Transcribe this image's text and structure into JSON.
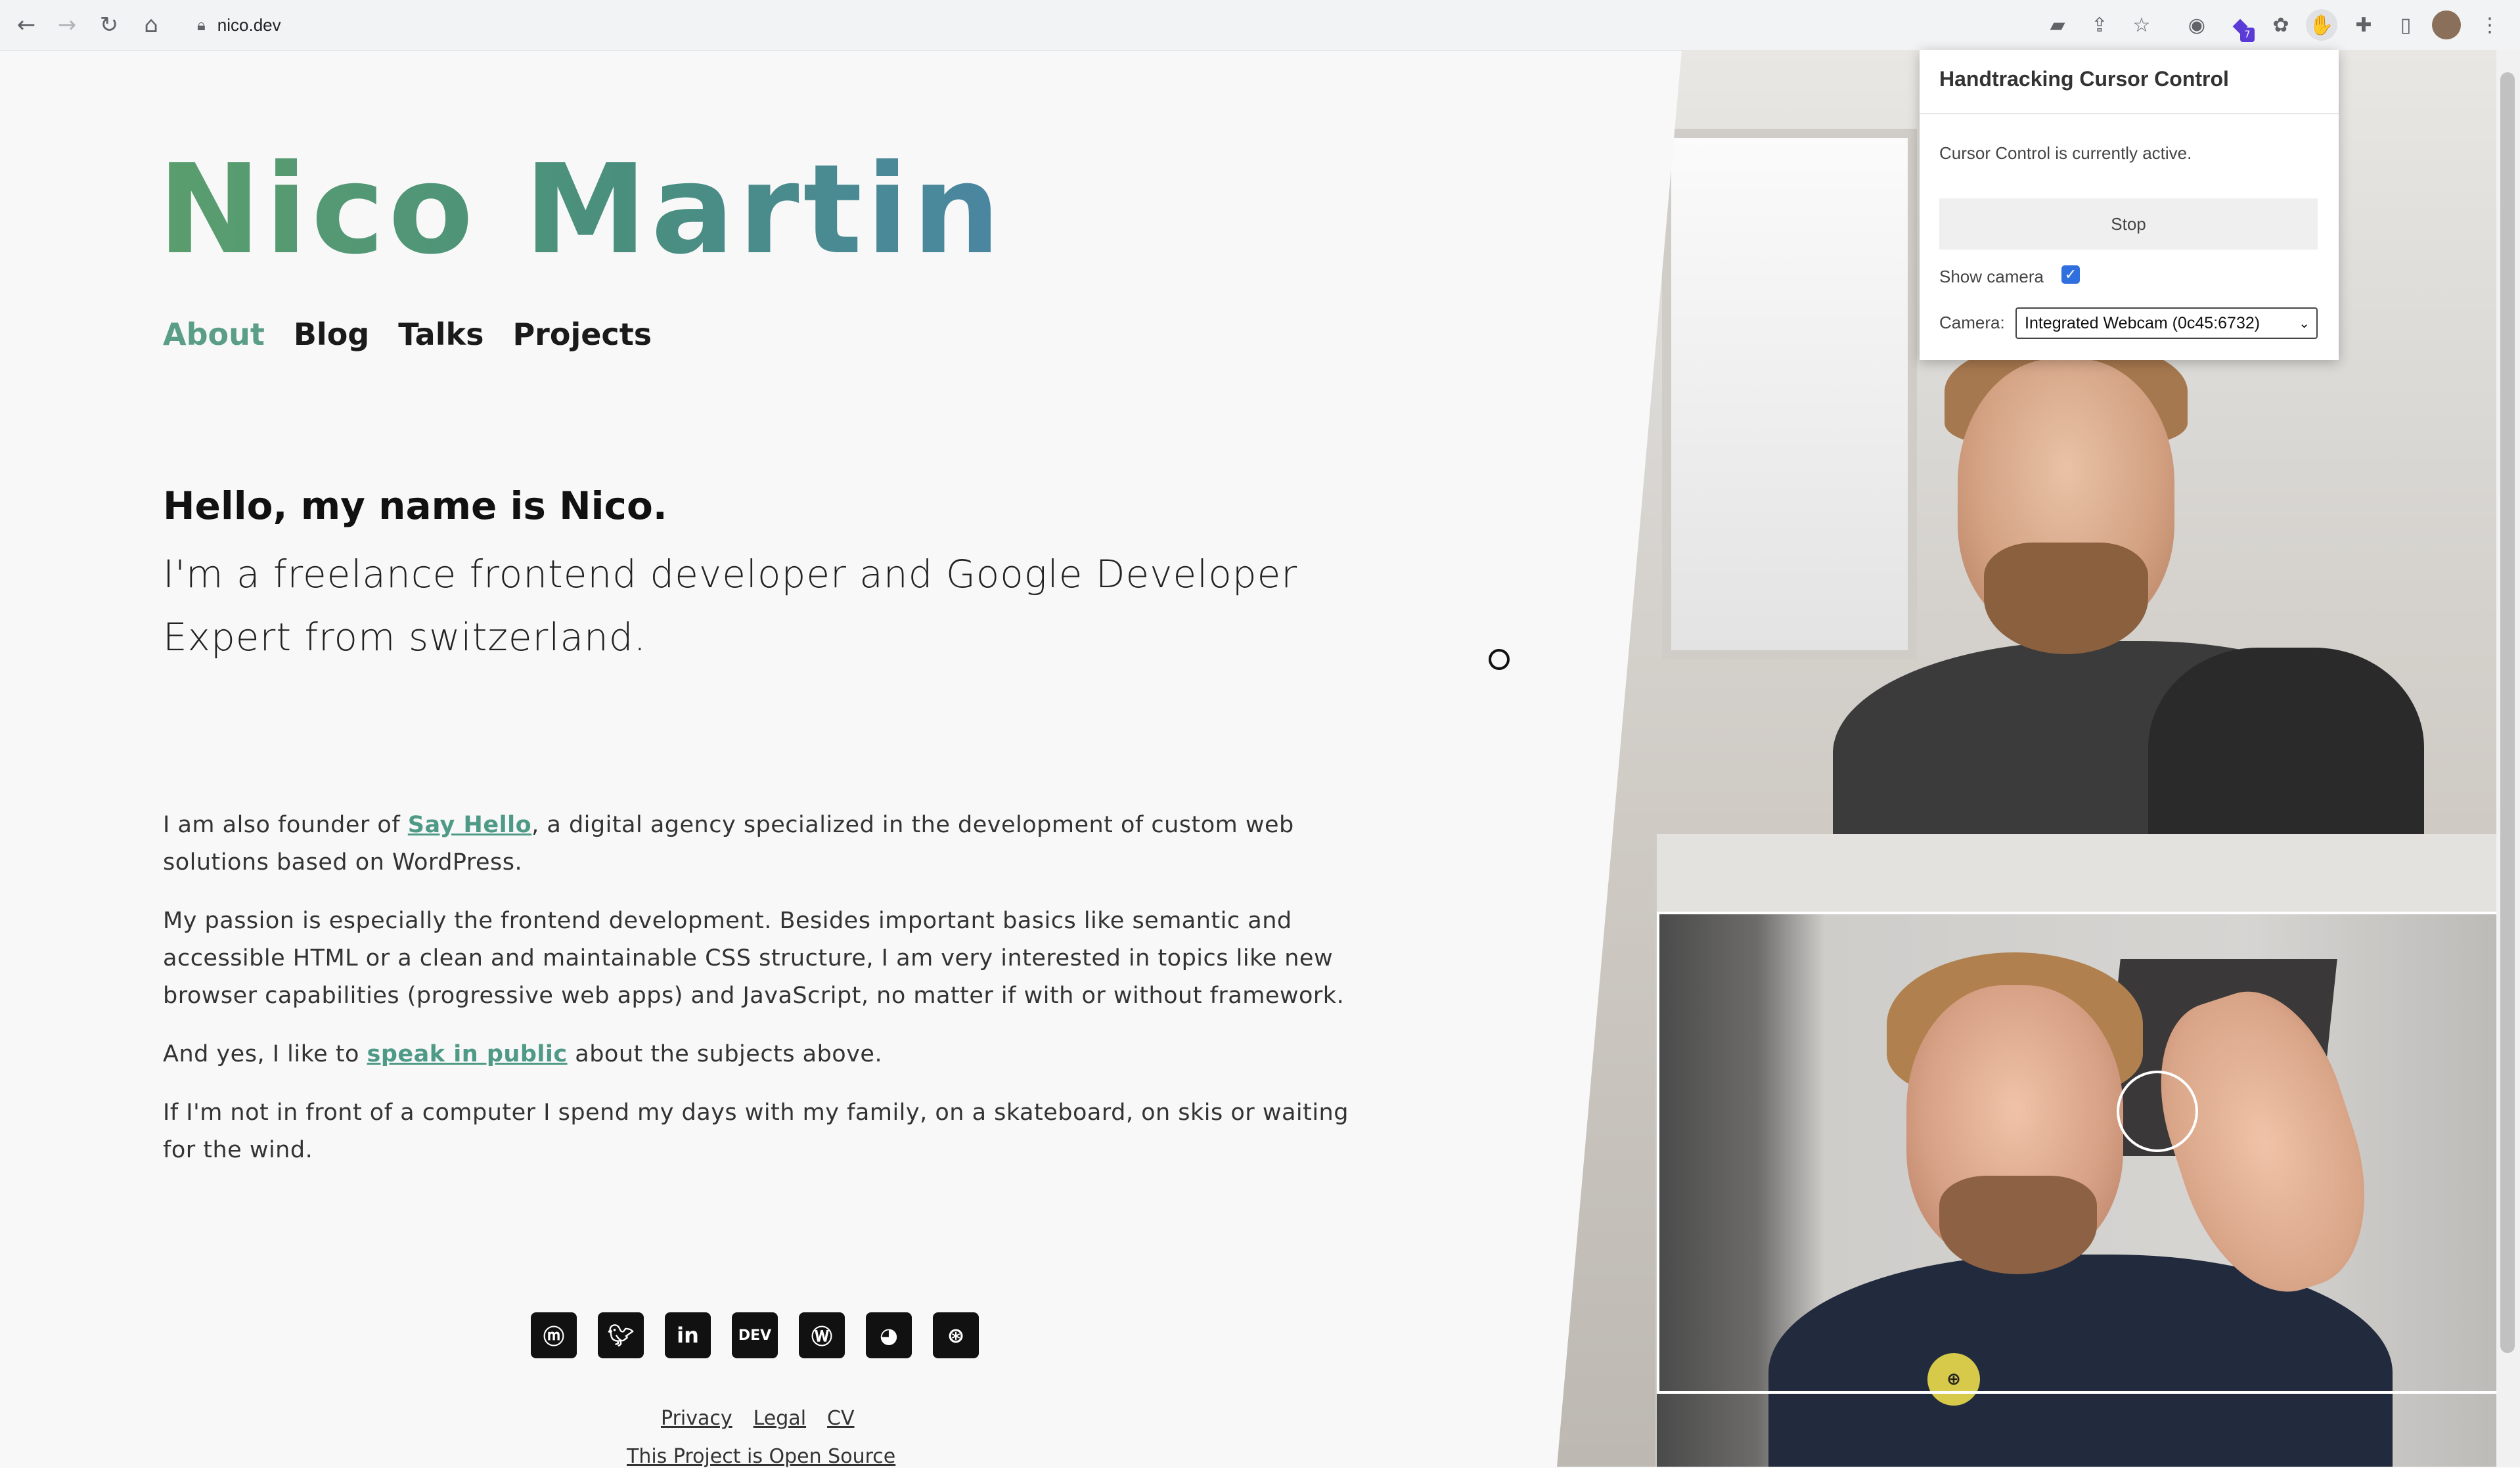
{
  "browser": {
    "url": "nico.dev",
    "icons": [
      "back-icon",
      "forward-icon",
      "reload-icon",
      "home-icon",
      "lock-icon",
      "camera-icon",
      "share-icon",
      "star-icon",
      "extension-icon",
      "puzzle-icon",
      "side-panel-icon",
      "menu-icon"
    ],
    "extension_badge": "7"
  },
  "site": {
    "title": "Nico Martin",
    "nav": [
      {
        "label": "About",
        "active": true
      },
      {
        "label": "Blog",
        "active": false
      },
      {
        "label": "Talks",
        "active": false
      },
      {
        "label": "Projects",
        "active": false
      }
    ],
    "intro_bold": "Hello, my name is Nico.",
    "intro": "I'm a freelance frontend developer and Google Developer Expert from switzerland.",
    "para1_before": "I am also founder of ",
    "para1_link": "Say Hello",
    "para1_after": ", a digital agency specialized in the development of custom web solutions based on WordPress.",
    "para2": "My passion is especially the frontend development. Besides important basics like semantic and accessible HTML or a clean and maintainable CSS structure, I am very interested in topics like new browser capabilities (progressive web apps) and JavaScript, no matter if with or without framework.",
    "para3_before": "And yes, I like to ",
    "para3_link": "speak in public",
    "para3_after": " about the subjects above.",
    "para4": "If I'm not in front of a computer I spend my days with my family, on a skateboard, on skis or waiting for the wind.",
    "social": [
      "mastodon-icon",
      "twitter-icon",
      "linkedin-icon",
      "dev-icon",
      "wordpress-icon",
      "github-icon",
      "dribbble-icon"
    ],
    "dev_label": "DEV",
    "footer_links": [
      "Privacy",
      "Legal",
      "CV"
    ],
    "footer_oss": "This Project is Open Source"
  },
  "popup": {
    "title": "Handtracking Cursor Control",
    "status": "Cursor Control is currently active.",
    "stop_label": "Stop",
    "show_camera_label": "Show camera",
    "show_camera_checked": true,
    "camera_label": "Camera:",
    "camera_selected": "Integrated Webcam (0c45:6732)"
  },
  "colors": {
    "accent": "#5a9e88",
    "title_gradient_start": "#5a9e6e",
    "title_gradient_end": "#4a86a2"
  }
}
